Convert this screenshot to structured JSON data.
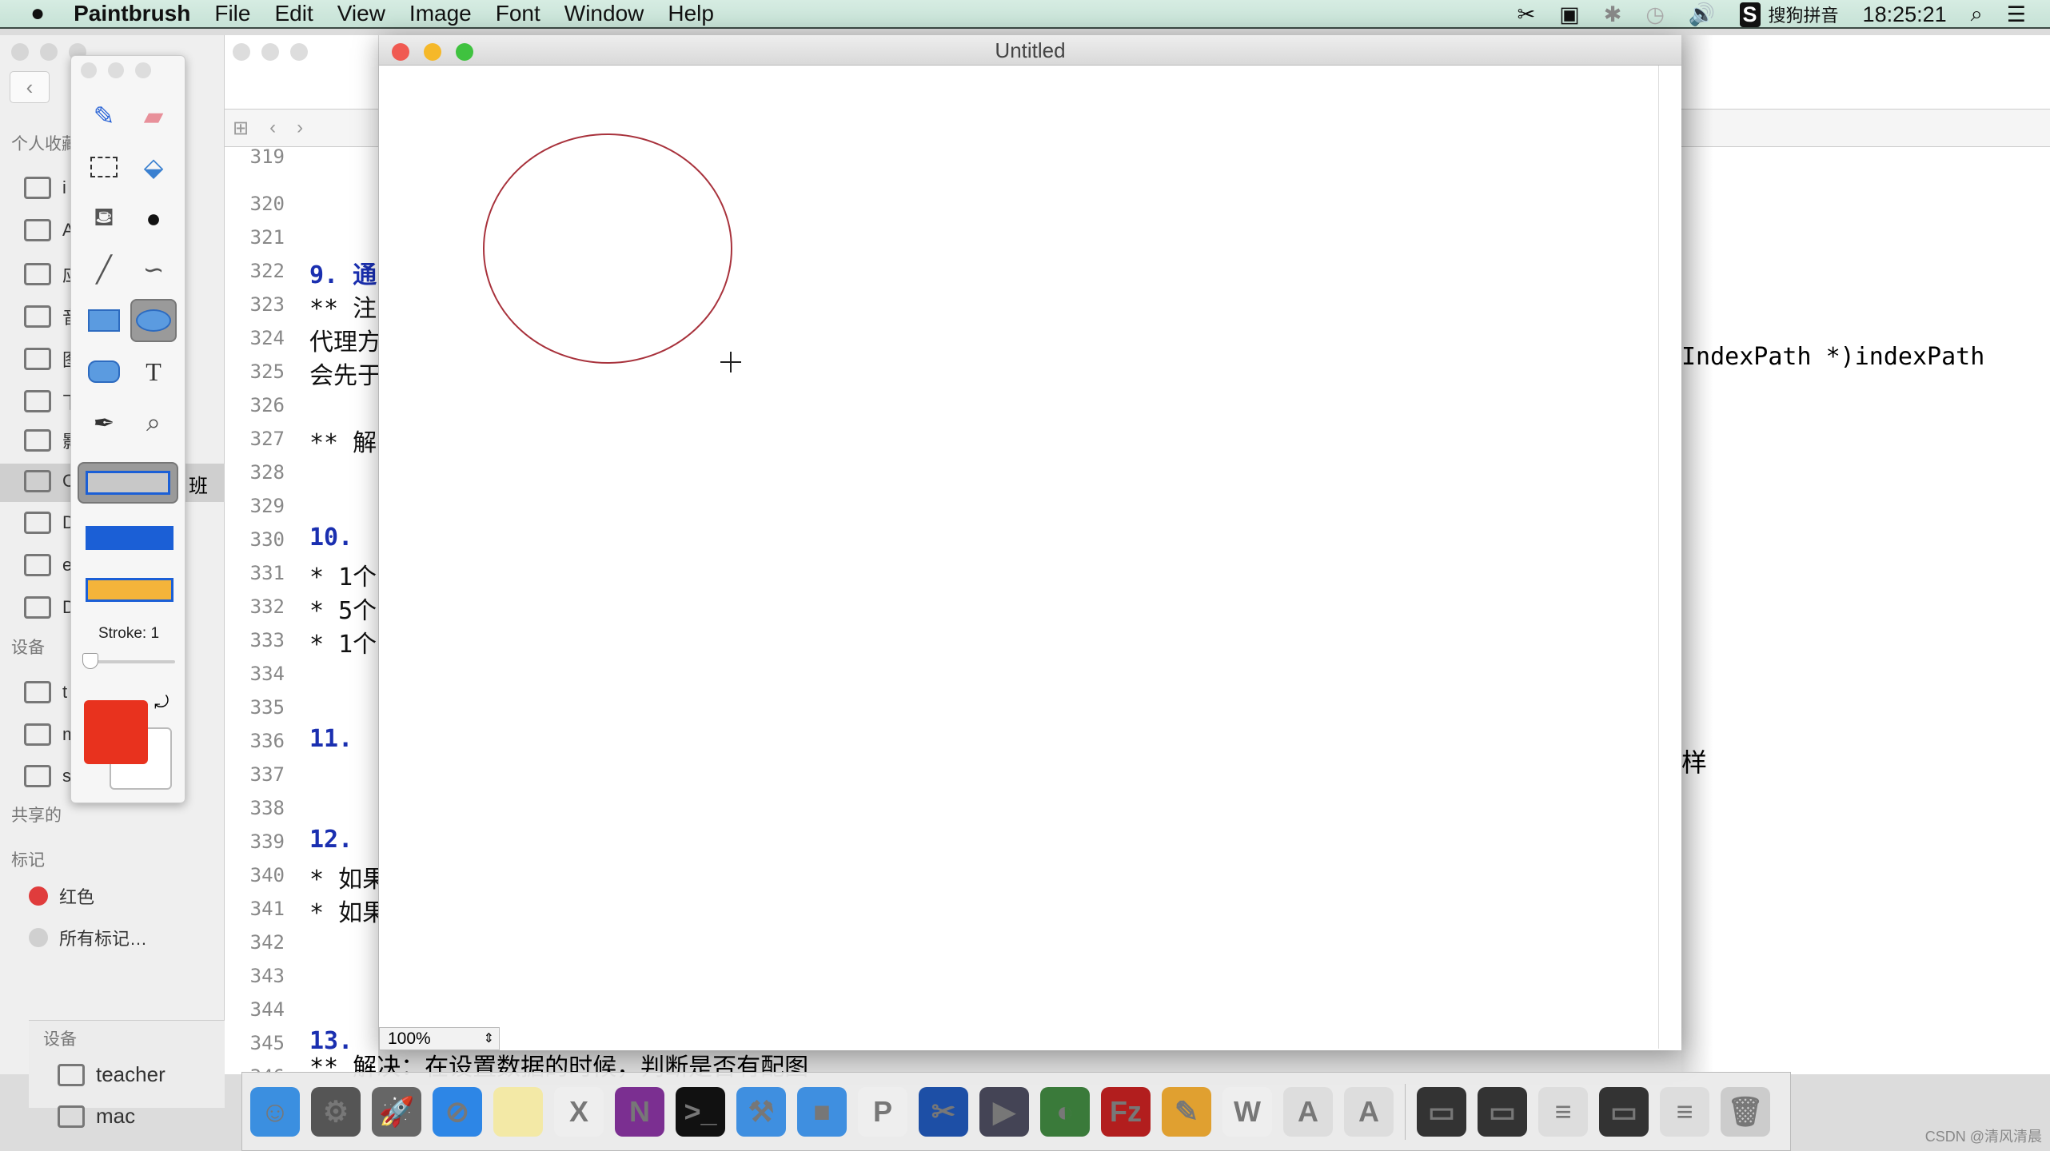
{
  "menubar": {
    "app_name": "Paintbrush",
    "items": [
      "File",
      "Edit",
      "View",
      "Image",
      "Font",
      "Window",
      "Help"
    ],
    "input_method": "搜狗拼音",
    "clock": "18:25:21",
    "status_icons": [
      "scissors-icon",
      "video-icon",
      "bluetooth-icon",
      "time-machine-icon",
      "volume-icon",
      "sogou-icon",
      "spotlight-icon",
      "notification-list-icon"
    ]
  },
  "finder_sidebar": {
    "favorites_heading": "个人收藏",
    "favorites": [
      {
        "icon": "icloud-icon",
        "label": "i"
      },
      {
        "icon": "airdrop-icon",
        "label": "A"
      },
      {
        "icon": "applications-icon",
        "label": "应"
      },
      {
        "icon": "music-icon",
        "label": "音"
      },
      {
        "icon": "camera-icon",
        "label": "图"
      },
      {
        "icon": "downloads-icon",
        "label": "下"
      },
      {
        "icon": "movies-icon",
        "label": "影"
      },
      {
        "icon": "folder-icon",
        "label": "C",
        "suffix": "班",
        "selected": true
      },
      {
        "icon": "documents-icon",
        "label": "D"
      },
      {
        "icon": "home-icon",
        "label": "e"
      },
      {
        "icon": "desktop-icon",
        "label": "D"
      }
    ],
    "devices_heading": "设备",
    "devices": [
      {
        "icon": "monitor-icon",
        "label": "t"
      },
      {
        "icon": "disk-icon",
        "label": "m"
      },
      {
        "icon": "drive-icon",
        "label": "s"
      }
    ],
    "shared_heading": "共享的",
    "tags_heading": "标记",
    "tags": [
      {
        "label": "红色",
        "color": "#e03c3c"
      },
      {
        "label": "所有标记…",
        "color": "#d0d0d0"
      }
    ],
    "back_devices_heading": "设备",
    "back_devices": [
      "teacher",
      "mac"
    ]
  },
  "editor": {
    "first_line_partial": "319",
    "lines": [
      {
        "n": "320",
        "text": ""
      },
      {
        "n": "321",
        "text": ""
      },
      {
        "n": "322",
        "text": "9. 通",
        "num": true
      },
      {
        "n": "323",
        "text": "** 注"
      },
      {
        "n": "324",
        "text": "代理方"
      },
      {
        "n": "325",
        "text": "会先于"
      },
      {
        "n": "326",
        "text": ""
      },
      {
        "n": "327",
        "text": "** 解"
      },
      {
        "n": "328",
        "text": ""
      },
      {
        "n": "329",
        "text": ""
      },
      {
        "n": "330",
        "text": "10.",
        "num": true
      },
      {
        "n": "331",
        "text": "* 1个"
      },
      {
        "n": "332",
        "text": "* 5个"
      },
      {
        "n": "333",
        "text": "* 1个"
      },
      {
        "n": "334",
        "text": ""
      },
      {
        "n": "335",
        "text": ""
      },
      {
        "n": "336",
        "text": "11.",
        "num": true
      },
      {
        "n": "337",
        "text": ""
      },
      {
        "n": "338",
        "text": ""
      },
      {
        "n": "339",
        "text": "12.",
        "num": true
      },
      {
        "n": "340",
        "text": "* 如果"
      },
      {
        "n": "341",
        "text": "* 如果"
      },
      {
        "n": "342",
        "text": ""
      },
      {
        "n": "343",
        "text": ""
      },
      {
        "n": "344",
        "text": ""
      },
      {
        "n": "345",
        "text": "13.",
        "num": true
      },
      {
        "n": "346",
        "text": "** 解决：在设置数据的时候，判断是否有配图"
      }
    ],
    "right_fragment_1": "IndexPath *)indexPath",
    "right_fragment_2": "样"
  },
  "paint_window": {
    "title": "Untitled",
    "zoom_value": "100%",
    "canvas": {
      "shape": "ellipse",
      "stroke_color": "#a8323c",
      "stroke_width": 1
    }
  },
  "toolbox": {
    "tools": [
      "brush-icon",
      "eraser-icon",
      "selection-icon",
      "bucket-select-icon",
      "fill-bucket-icon",
      "bomb-icon",
      "line-icon",
      "curve-icon",
      "rectangle-icon",
      "ellipse-icon",
      "rounded-rect-icon",
      "text-icon",
      "eyedropper-icon",
      "zoom-icon"
    ],
    "selected_tool": "ellipse-icon",
    "text_tool_glyph": "T",
    "stroke_label": "Stroke: 1",
    "stroke_value": 1,
    "foreground_color": "#e8321e",
    "background_color": "#ffffff"
  },
  "dock": {
    "apps": [
      {
        "name": "finder",
        "color": "#3b8fe0",
        "glyph": "☺"
      },
      {
        "name": "system-preferences",
        "color": "#555",
        "glyph": "⚙"
      },
      {
        "name": "launchpad",
        "color": "#666",
        "glyph": "🚀"
      },
      {
        "name": "safari",
        "color": "#2d86e6",
        "glyph": "⊘"
      },
      {
        "name": "notes",
        "color": "#f3e9a6",
        "glyph": ""
      },
      {
        "name": "excel",
        "color": "#eee",
        "glyph": "X"
      },
      {
        "name": "onenote",
        "color": "#7b2f91",
        "glyph": "N"
      },
      {
        "name": "terminal",
        "color": "#111",
        "glyph": ">_"
      },
      {
        "name": "xcode",
        "color": "#3f8fe0",
        "glyph": "⚒"
      },
      {
        "name": "folder-app",
        "color": "#3f8fe0",
        "glyph": "■"
      },
      {
        "name": "powerpoint",
        "color": "#eee",
        "glyph": "P"
      },
      {
        "name": "snip",
        "color": "#1d4fa6",
        "glyph": "✂"
      },
      {
        "name": "movie-app",
        "color": "#445",
        "glyph": "▶"
      },
      {
        "name": "sequel",
        "color": "#3a7a3a",
        "glyph": "◐"
      },
      {
        "name": "filezilla",
        "color": "#b21e1e",
        "glyph": "Fz"
      },
      {
        "name": "sketch-app",
        "color": "#e0a030",
        "glyph": "✎"
      },
      {
        "name": "word",
        "color": "#eee",
        "glyph": "W"
      },
      {
        "name": "app-a-1",
        "color": "#ddd",
        "glyph": "A"
      },
      {
        "name": "app-a-2",
        "color": "#ddd",
        "glyph": "A"
      },
      {
        "name": "remote-1",
        "color": "#333",
        "glyph": "▭"
      },
      {
        "name": "remote-2",
        "color": "#333",
        "glyph": "▭"
      },
      {
        "name": "doc-1",
        "color": "#ddd",
        "glyph": "≡"
      },
      {
        "name": "remote-3",
        "color": "#333",
        "glyph": "▭"
      },
      {
        "name": "doc-2",
        "color": "#ddd",
        "glyph": "≡"
      },
      {
        "name": "trash",
        "color": "#ccc",
        "glyph": "🗑"
      }
    ]
  },
  "watermark": "CSDN @清风清晨"
}
